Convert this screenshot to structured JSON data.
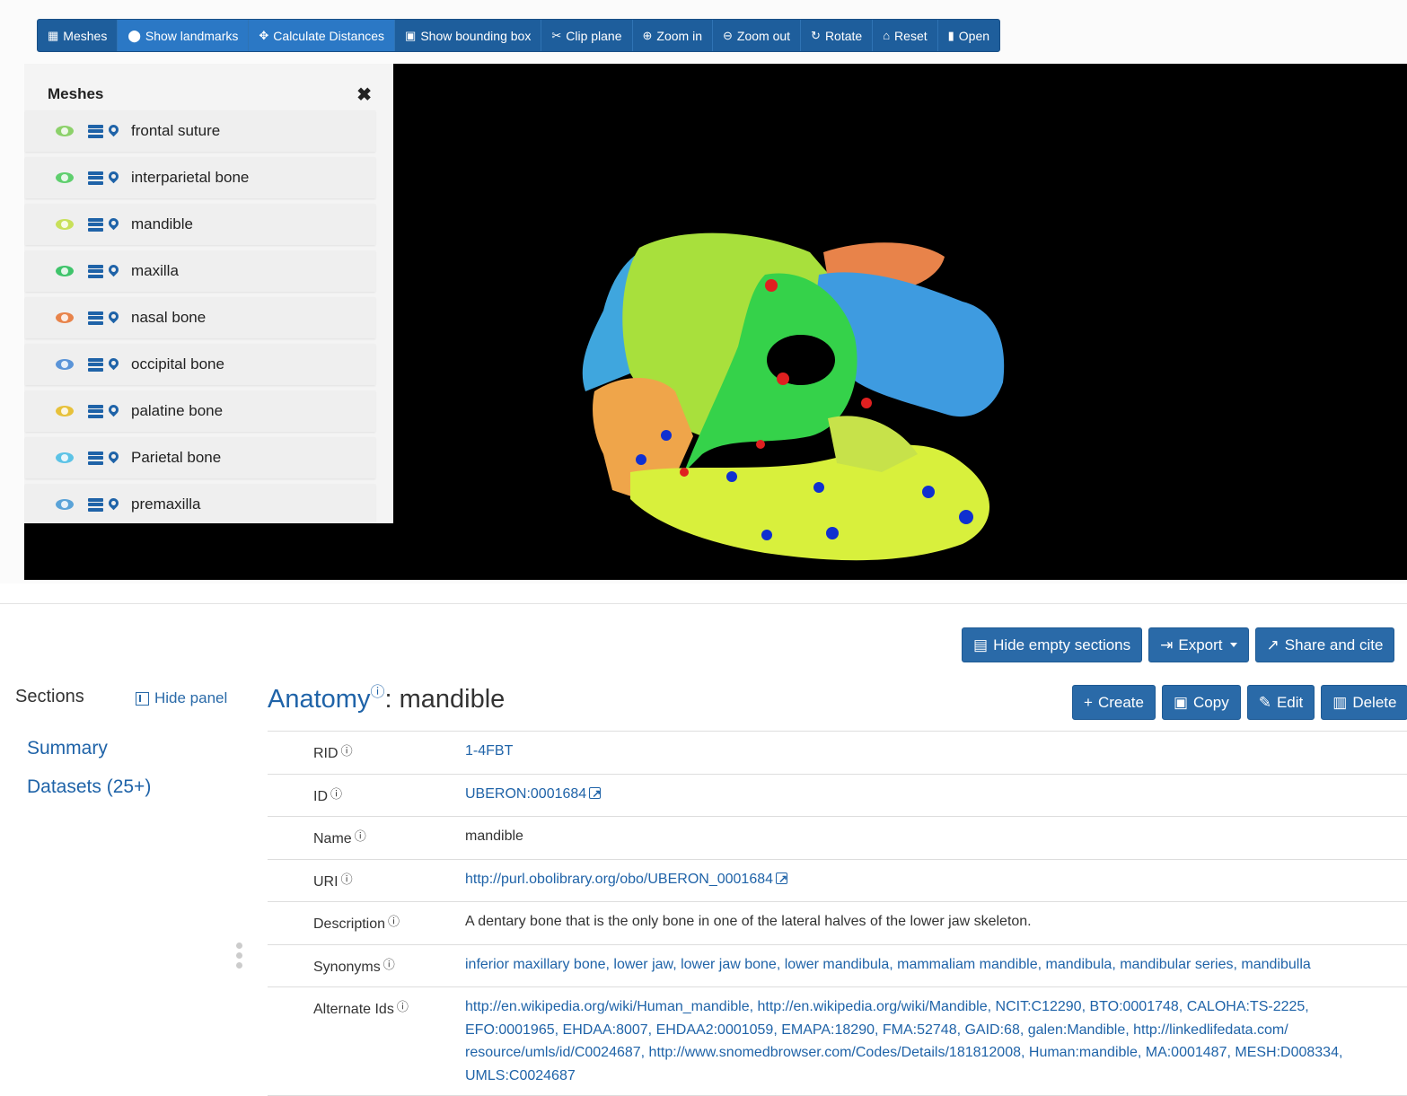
{
  "toolbar": {
    "buttons": [
      {
        "label": "Meshes",
        "icon": "grid-icon"
      },
      {
        "label": "Show landmarks",
        "icon": "map-marker-icon"
      },
      {
        "label": "Calculate Distances",
        "icon": "arrows-icon"
      },
      {
        "label": "Show bounding box",
        "icon": "image-icon"
      },
      {
        "label": "Clip plane",
        "icon": "scissors-icon"
      },
      {
        "label": "Zoom in",
        "icon": "zoom-in-icon"
      },
      {
        "label": "Zoom out",
        "icon": "zoom-out-icon"
      },
      {
        "label": "Rotate",
        "icon": "rotate-icon"
      },
      {
        "label": "Reset",
        "icon": "home-icon"
      },
      {
        "label": "Open",
        "icon": "file-icon"
      }
    ]
  },
  "mesh_panel": {
    "title": "Meshes",
    "close": "✖",
    "items": [
      {
        "label": "frontal suture",
        "color": "#8cd16a"
      },
      {
        "label": "interparietal bone",
        "color": "#5fcf6e"
      },
      {
        "label": "mandible",
        "color": "#c8e05a"
      },
      {
        "label": "maxilla",
        "color": "#3fc46b"
      },
      {
        "label": "nasal bone",
        "color": "#e8834a"
      },
      {
        "label": "occipital bone",
        "color": "#5a94d8"
      },
      {
        "label": "palatine bone",
        "color": "#e7c13a"
      },
      {
        "label": "Parietal bone",
        "color": "#5cc3e6"
      },
      {
        "label": "premaxilla",
        "color": "#5aa3d8"
      }
    ]
  },
  "page_actions": {
    "hide_empty": "Hide empty sections",
    "export": "Export",
    "share": "Share and cite"
  },
  "sections": {
    "label": "Sections",
    "hide_panel": "Hide panel",
    "summary": "Summary",
    "datasets": "Datasets (25+)"
  },
  "record": {
    "table_name": "Anatomy",
    "info_mark": "ⓘ",
    "title_separator": ": ",
    "name": "mandible",
    "actions": {
      "create": "Create",
      "copy": "Copy",
      "edit": "Edit",
      "delete": "Delete"
    },
    "rows": {
      "rid": {
        "key": "RID",
        "value": "1-4FBT"
      },
      "id": {
        "key": "ID",
        "value": "UBERON:0001684"
      },
      "name": {
        "key": "Name",
        "value": "mandible"
      },
      "uri": {
        "key": "URI",
        "value": "http://purl.obolibrary.org/obo/UBERON_0001684"
      },
      "description": {
        "key": "Description",
        "value": "A dentary bone that is the only bone in one of the lateral halves of the lower jaw skeleton."
      },
      "synonyms": {
        "key": "Synonyms",
        "value": "inferior maxillary bone, lower jaw, lower jaw bone, lower mandibula, mammaliam mandible, mandibula, mandibular series, mandibulla"
      },
      "alternate_ids": {
        "key": "Alternate Ids",
        "value": "http://en.wikipedia.org/wiki/Human_mandible, http://en.wikipedia.org/wiki/Mandible, NCIT:C12290, BTO:0001748, CALOHA:TS-2225, EFO:0001965, EHDAA:8007, EHDAA2:0001059, EMAPA:18290, FMA:52748, GAID:68, galen:Mandible, http://linkedlifedata.com/ resource/umls/id/C0024687, http://www.snomedbrowser.com/Codes/Details/181812008, Human:mandible, MA:0001487, MESH:D008334, UMLS:C0024687"
      }
    }
  }
}
